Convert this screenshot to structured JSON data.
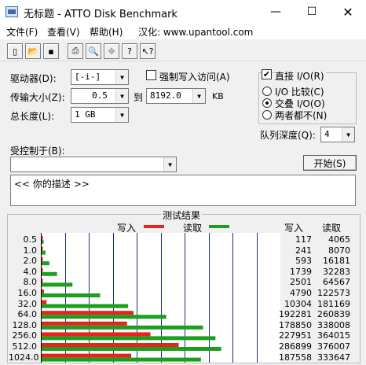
{
  "window": {
    "title": "无标题 - ATTO Disk Benchmark"
  },
  "menu": [
    {
      "label": "文件(F)"
    },
    {
      "label": "查看(V)"
    },
    {
      "label": "帮助(H)"
    },
    {
      "label": "汉化: www.upantool.com"
    }
  ],
  "settings": {
    "drive_label": "驱动器(D):",
    "drive_value": "[-i-]",
    "transfer_label": "传输大小(Z):",
    "transfer_from": "0.5",
    "to_label": "到",
    "transfer_to": "8192.0",
    "unit": "KB",
    "length_label": "总长度(L):",
    "length_value": "1 GB",
    "force_write_label": "强制写入访问(A)",
    "direct_io_label": "直接 I/O(R)",
    "io_compare_label": "I/O 比较(C)",
    "overlapped_io_label": "交叠 I/O(O)",
    "neither_label": "两者都不(N)",
    "queue_depth_label": "队列深度(Q):",
    "queue_depth_value": "4",
    "controlled_by_label": "受控制于(B):",
    "controlled_by_value": "",
    "start_button": "开始(S)",
    "description": "<<  你的描述  >>"
  },
  "results": {
    "title": "测试结果",
    "write_legend": "写入",
    "read_legend": "读取",
    "write_header": "写入",
    "read_header": "读取",
    "write_color": "#e8231e",
    "read_color": "#1e9e1e"
  },
  "chart_data": {
    "type": "bar",
    "categories": [
      "0.5",
      "1.0",
      "2.0",
      "4.0",
      "8.0",
      "16.0",
      "32.0",
      "64.0",
      "128.0",
      "256.0",
      "512.0",
      "1024.0"
    ],
    "series": [
      {
        "name": "写入",
        "values": [
          117,
          241,
          593,
          1739,
          2501,
          4790,
          10304,
          192281,
          178850,
          227951,
          286899,
          187558
        ]
      },
      {
        "name": "读取",
        "values": [
          4065,
          8070,
          16181,
          32283,
          64567,
          122573,
          181169,
          260839,
          338008,
          364015,
          376007,
          333647
        ]
      }
    ],
    "xlim": [
      0,
      500000
    ]
  }
}
